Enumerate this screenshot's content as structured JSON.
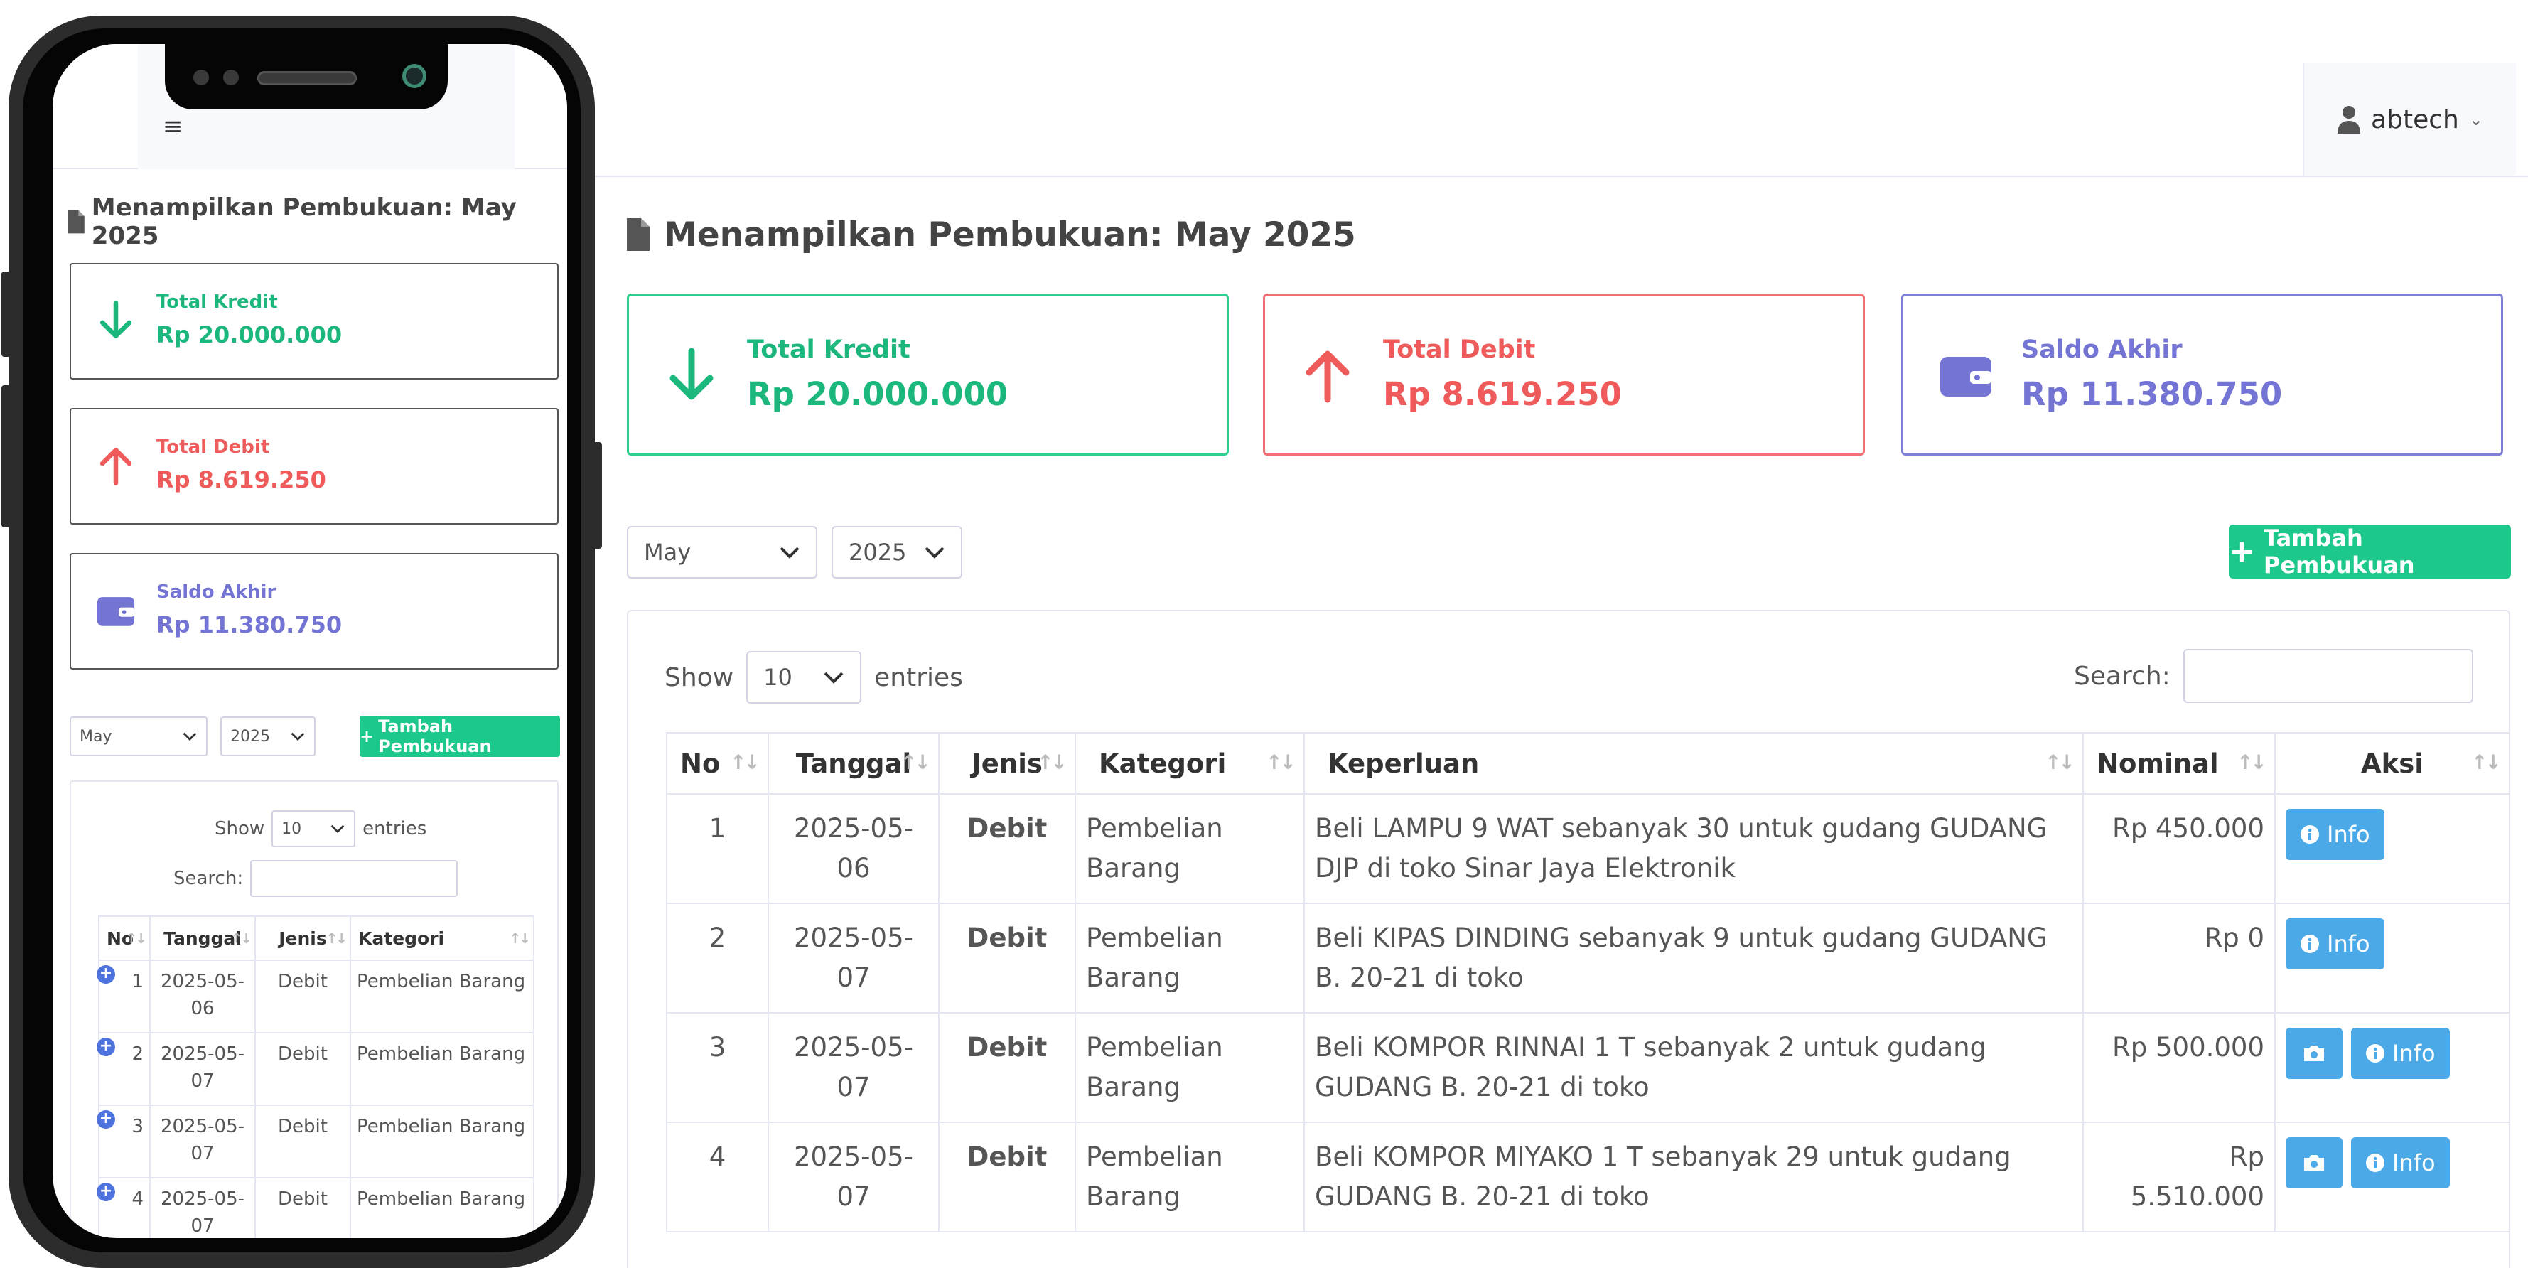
{
  "user": {
    "name": "abtech"
  },
  "title": "Menampilkan Pembukuan: May 2025",
  "cards": {
    "kredit": {
      "label": "Total Kredit",
      "value": "Rp 20.000.000"
    },
    "debit": {
      "label": "Total Debit",
      "value": "Rp 8.619.250"
    },
    "saldo": {
      "label": "Saldo Akhir",
      "value": "Rp 11.380.750"
    }
  },
  "filters": {
    "month": "May",
    "year": "2025",
    "add_button": "Tambah Pembukuan"
  },
  "datatable": {
    "show": "Show",
    "length": "10",
    "entries": "entries",
    "search_label": "Search:"
  },
  "columns": {
    "no": "No",
    "tanggal": "Tanggal",
    "jenis": "Jenis",
    "kategori": "Kategori",
    "keperluan": "Keperluan",
    "nominal": "Nominal",
    "aksi": "Aksi"
  },
  "rows": [
    {
      "no": "1",
      "tanggal": "2025-05-06",
      "jenis": "Debit",
      "kategori": "Pembelian Barang",
      "keperluan": "Beli LAMPU 9 WAT sebanyak 30 untuk gudang GUDANG DJP di toko Sinar Jaya Elektronik",
      "nominal": "Rp 450.000"
    },
    {
      "no": "2",
      "tanggal": "2025-05-07",
      "jenis": "Debit",
      "kategori": "Pembelian Barang",
      "keperluan": "Beli KIPAS DINDING sebanyak 9 untuk gudang GUDANG B. 20-21 di toko",
      "nominal": "Rp 0"
    },
    {
      "no": "3",
      "tanggal": "2025-05-07",
      "jenis": "Debit",
      "kategori": "Pembelian Barang",
      "keperluan": "Beli KOMPOR RINNAI 1 T sebanyak 2 untuk gudang GUDANG B. 20-21 di toko",
      "nominal": "Rp 500.000"
    },
    {
      "no": "4",
      "tanggal": "2025-05-07",
      "jenis": "Debit",
      "kategori": "Pembelian Barang",
      "keperluan": "Beli KOMPOR MIYAKO 1 T sebanyak 29 untuk gudang GUDANG B. 20-21 di toko",
      "nominal": "Rp 5.510.000"
    }
  ],
  "actions": {
    "info": "Info"
  },
  "icons": [
    "user-icon",
    "chevron-down-icon",
    "file-icon",
    "arrow-down-icon",
    "arrow-up-icon",
    "wallet-icon",
    "plus-icon",
    "info-circle-icon",
    "camera-icon",
    "hamburger-icon",
    "expand-row-icon",
    "sort-icon"
  ],
  "colors": {
    "green": "#1cc88a",
    "red": "#e74a3b",
    "purple": "#7474d4",
    "info": "#4aa9e6"
  }
}
